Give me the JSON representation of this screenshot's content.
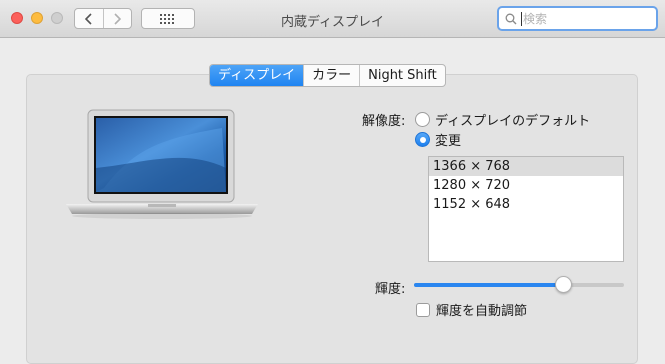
{
  "window": {
    "title": "内蔵ディスプレイ",
    "search_placeholder": "検索"
  },
  "icons": {
    "back": "chevron-left-icon",
    "forward": "chevron-right-icon",
    "show_all": "grid-icon",
    "search": "search-icon"
  },
  "tabs": [
    {
      "label": "ディスプレイ",
      "active": true
    },
    {
      "label": "カラー",
      "active": false
    },
    {
      "label": "Night Shift",
      "active": false
    }
  ],
  "resolution": {
    "label": "解像度:",
    "options": [
      {
        "label": "ディスプレイのデフォルト",
        "selected": false
      },
      {
        "label": "変更",
        "selected": true
      }
    ],
    "list": [
      "1366 × 768",
      "1280 × 720",
      "1152 × 648"
    ],
    "selected_index": 0
  },
  "brightness": {
    "label": "輝度:",
    "value": 0.73,
    "auto_label": "輝度を自動調節",
    "auto_checked": false
  },
  "colors": {
    "accent": "#2a86f0",
    "close": "#fc605b",
    "minimize": "#fdbc40",
    "zoom_inactive": "#cfcfcf"
  }
}
